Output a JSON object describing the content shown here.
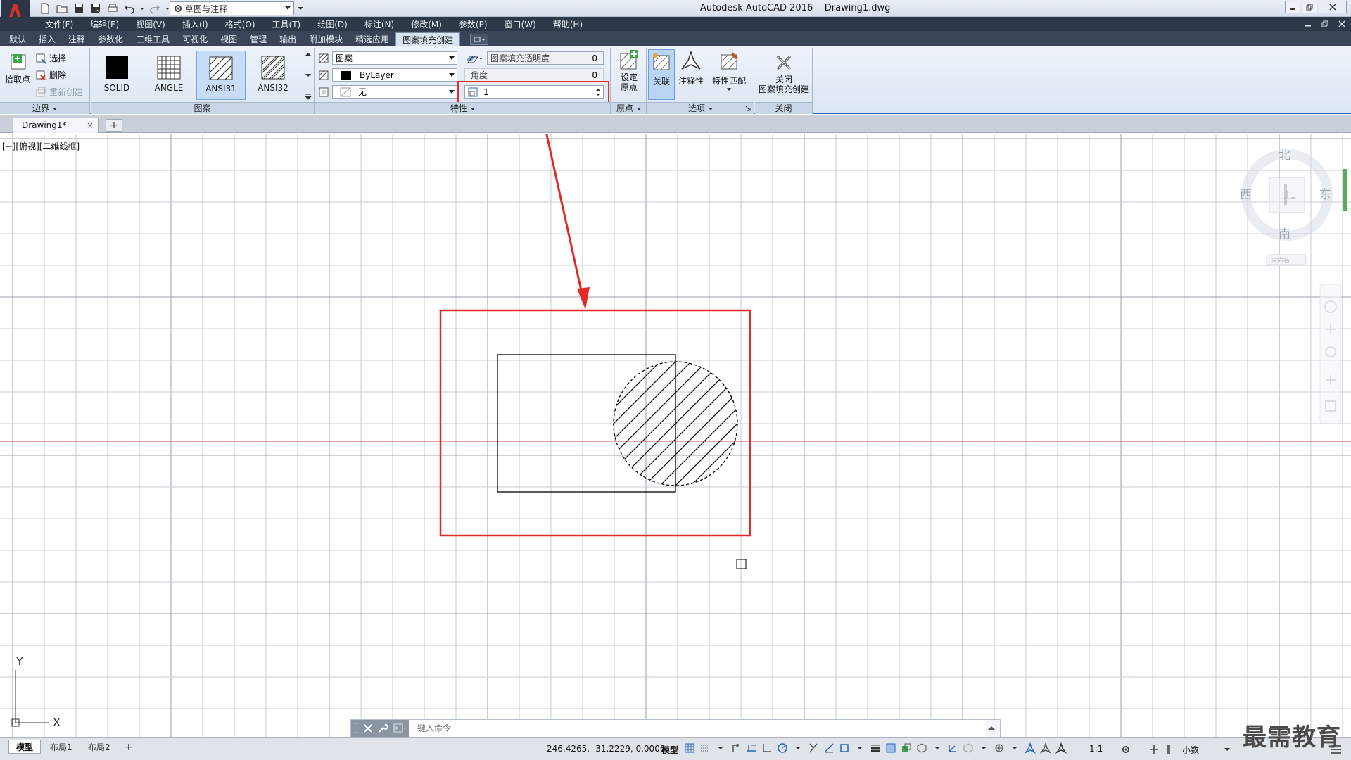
{
  "titlebar": {
    "workspace": "草图与注释",
    "app_title": "Autodesk AutoCAD 2016    Drawing1.dwg"
  },
  "menu": [
    "文件(F)",
    "编辑(E)",
    "视图(V)",
    "插入(I)",
    "格式(O)",
    "工具(T)",
    "绘图(D)",
    "标注(N)",
    "修改(M)",
    "参数(P)",
    "窗口(W)",
    "帮助(H)"
  ],
  "ribbon_tabs": [
    "默认",
    "插入",
    "注释",
    "参数化",
    "三维工具",
    "可视化",
    "视图",
    "管理",
    "输出",
    "附加模块",
    "精选应用",
    "图案填充创建"
  ],
  "ribbon_active_tab": "图案填充创建",
  "boundary": {
    "pick_points": "拾取点",
    "select": "选择",
    "remove": "删除",
    "recreate": "重新创建",
    "label": "边界"
  },
  "patterns": {
    "items": [
      "SOLID",
      "ANGLE",
      "ANSI31",
      "ANSI32"
    ],
    "selected": "ANSI31",
    "label": "图案"
  },
  "properties": {
    "type": "图案",
    "color": "ByLayer",
    "background": "无",
    "transparency_label": "图案填充透明度",
    "transparency_value": "0",
    "angle_label": "角度",
    "angle_value": "0",
    "scale_value": "1",
    "label": "特性"
  },
  "origin": {
    "set_origin": "设定\n原点",
    "label": "原点"
  },
  "options": {
    "associative": "关联",
    "annotative": "注释性",
    "match": "特性匹配",
    "label": "选项"
  },
  "close": {
    "button": "关闭\n图案填充创建",
    "label": "关闭"
  },
  "doc_tab": {
    "name": "Drawing1*",
    "close": "×",
    "new": "+"
  },
  "viewport_label": "[−][俯视][二维线框]",
  "viewcube": {
    "north": "北",
    "south": "南",
    "east": "东",
    "west": "西",
    "face": "上",
    "wcs": "未命名"
  },
  "cmdline": {
    "placeholder": "键入命令"
  },
  "ucs": {
    "x": "X",
    "y": "Y"
  },
  "status": {
    "layouts": [
      "模型",
      "布局1",
      "布局2"
    ],
    "add_layout": "+",
    "coords": "246.4265, -31.2229, 0.0000",
    "model": "模型",
    "scale": "1:1",
    "units": "小数"
  },
  "watermark": "最需教育",
  "colors": {
    "highlight": "#e32a27",
    "ribbon_accent": "#2a65b0",
    "axis_line": "#c9504a"
  }
}
